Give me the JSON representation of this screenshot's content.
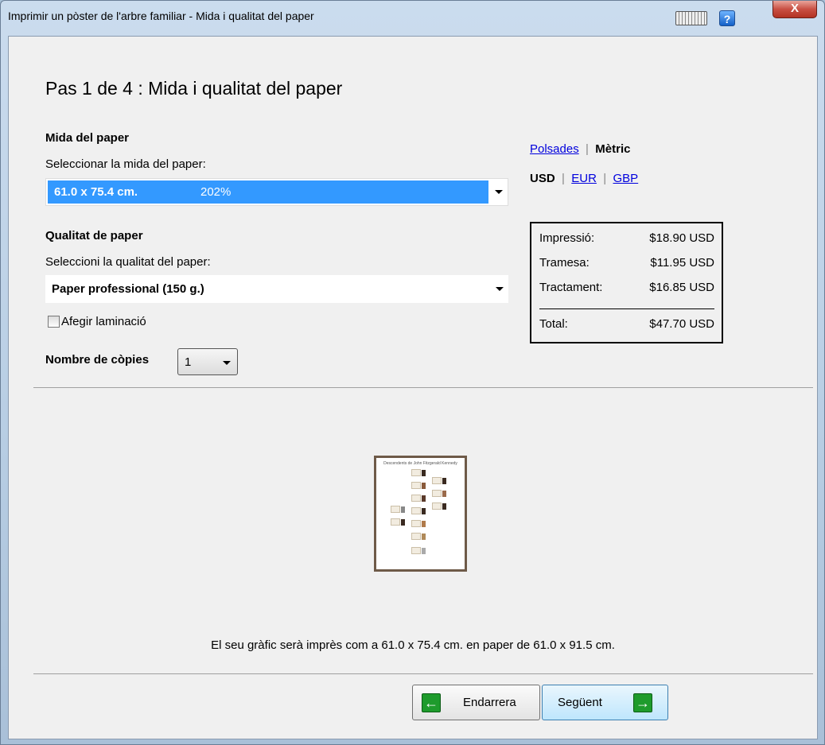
{
  "window": {
    "title": "Imprimir un pòster de l'arbre familiar - Mida i qualitat del paper",
    "close_label": "X",
    "help_label": "?"
  },
  "heading": "Pas 1 de 4 : Mida i qualitat del paper",
  "paper_size": {
    "section_label": "Mida del paper",
    "prompt": "Seleccionar la mida del paper:",
    "selected_value": "61.0 x 75.4 cm.",
    "selected_percent": "202%"
  },
  "paper_quality": {
    "section_label": "Qualitat de paper",
    "prompt": "Seleccioni la qualitat del paper:",
    "selected_value": "Paper professional (150 g.)",
    "laminate_label": "Afegir laminació",
    "laminate_checked": false
  },
  "copies": {
    "label": "Nombre de còpies",
    "value": "1"
  },
  "units": {
    "imperial": "Polsades",
    "metric": "Mètric",
    "active": "Mètric"
  },
  "currency": {
    "usd": "USD",
    "eur": "EUR",
    "gbp": "GBP",
    "active": "USD"
  },
  "price": {
    "rows": [
      {
        "label": "Impressió:",
        "value": "$18.90 USD"
      },
      {
        "label": "Tramesa:",
        "value": "$11.95 USD"
      },
      {
        "label": "Tractament:",
        "value": "$16.85 USD"
      }
    ],
    "total_label": "Total:",
    "total_value": "$47.70 USD"
  },
  "poster_preview": {
    "title": "Descendents de John Fitzgerald Kennedy"
  },
  "summary_text": "El seu gràfic serà imprès com a 61.0 x 75.4 cm. en paper de 61.0 x 91.5 cm.",
  "buttons": {
    "back": "Endarrera",
    "next": "Següent"
  },
  "colors": {
    "selection": "#3399ff",
    "link": "#0000dd",
    "arrow_green": "#1e9b2c"
  }
}
